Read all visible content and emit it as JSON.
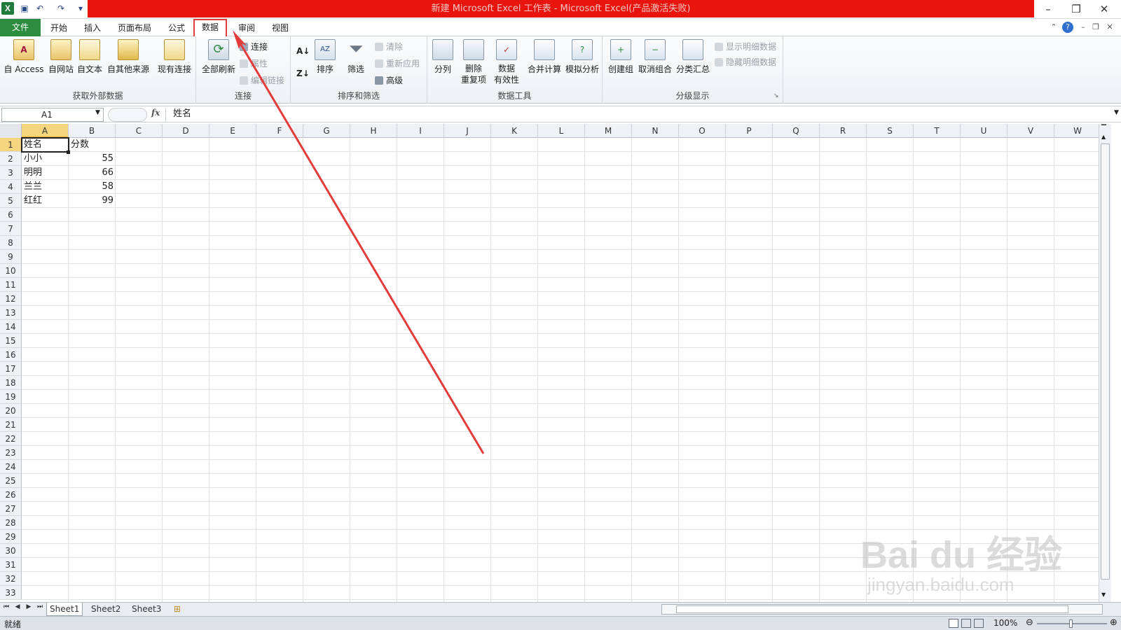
{
  "window": {
    "title": "新建 Microsoft Excel 工作表 - Microsoft Excel(产品激活失败)",
    "min": "–",
    "restore": "❐",
    "close": "✕"
  },
  "qat": {
    "logo": "X",
    "save": "💾",
    "undo": "↶",
    "redo": "↷",
    "more": "▾"
  },
  "tabs": [
    {
      "label": "文件"
    },
    {
      "label": "开始"
    },
    {
      "label": "插入"
    },
    {
      "label": "页面布局"
    },
    {
      "label": "公式"
    },
    {
      "label": "数据"
    },
    {
      "label": "审阅"
    },
    {
      "label": "视图"
    }
  ],
  "ribbon": {
    "groups": {
      "external": "获取外部数据",
      "connections": "连接",
      "sortfilter": "排序和筛选",
      "datatools": "数据工具",
      "outline": "分级显示"
    },
    "buttons": {
      "access": "自 Access",
      "web": "自网站",
      "text": "自文本",
      "other": "自其他来源",
      "existing": "现有连接",
      "refresh": "全部刷新",
      "connections": "连接",
      "properties": "属性",
      "editlinks": "编辑链接",
      "sort": "排序",
      "filter": "筛选",
      "clear": "清除",
      "reapply": "重新应用",
      "advanced": "高级",
      "t2c": "分列",
      "remove_dup_1": "删除",
      "remove_dup_2": "重复项",
      "validation_1": "数据",
      "validation_2": "有效性",
      "consolidate": "合并计算",
      "whatif": "模拟分析",
      "group": "创建组",
      "ungroup": "取消组合",
      "subtotal": "分类汇总",
      "show_detail": "显示明细数据",
      "hide_detail": "隐藏明细数据"
    },
    "accent": "#2c8d3f",
    "highlight": "#e43b3b"
  },
  "formula_bar": {
    "namebox": "A1",
    "fx": "fx",
    "content": "姓名"
  },
  "columns": [
    "A",
    "B",
    "C",
    "D",
    "E",
    "F",
    "G",
    "H",
    "I",
    "J",
    "K",
    "L",
    "M",
    "N",
    "O",
    "P",
    "Q",
    "R",
    "S",
    "T",
    "U",
    "V",
    "W"
  ],
  "rows": [
    "1",
    "2",
    "3",
    "4",
    "5",
    "6",
    "7",
    "8",
    "9",
    "10",
    "11",
    "12",
    "13",
    "14",
    "15",
    "16",
    "17",
    "18",
    "19",
    "20",
    "21",
    "22",
    "23",
    "24",
    "25",
    "26",
    "27",
    "28",
    "29",
    "30",
    "31",
    "32",
    "33"
  ],
  "cells": {
    "a1": "姓名",
    "b1": "分数",
    "a2": "小小",
    "b2": "55",
    "a3": "明明",
    "b3": "66",
    "a4": "兰兰",
    "b4": "58",
    "a5": "红红",
    "b5": "99"
  },
  "sheets": [
    "Sheet1",
    "Sheet2",
    "Sheet3"
  ],
  "status": {
    "ready": "就绪",
    "zoom": "100%"
  },
  "watermark": {
    "main": "Bai du 经验",
    "sub": "jingyan.baidu.com"
  }
}
